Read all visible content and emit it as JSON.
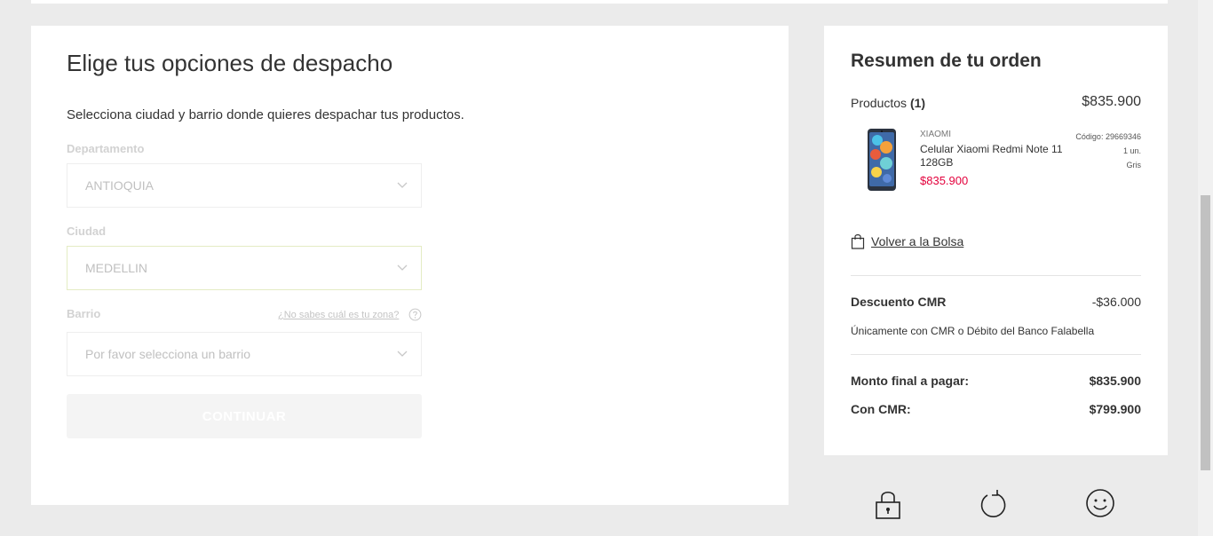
{
  "shipping": {
    "title": "Elige tus opciones de despacho",
    "subtitle": "Selecciona ciudad y barrio donde quieres despachar tus productos.",
    "department": {
      "label": "Departamento",
      "value": "ANTIOQUIA"
    },
    "city": {
      "label": "Ciudad",
      "value": "MEDELLIN"
    },
    "neighborhood": {
      "label": "Barrio",
      "help_link": "¿No sabes cuál es tu zona?",
      "placeholder": "Por favor selecciona un barrio"
    },
    "continue_label": "CONTINUAR"
  },
  "summary": {
    "title": "Resumen de tu orden",
    "products_label": "Productos",
    "products_count": "(1)",
    "products_total": "$835.900",
    "item": {
      "brand": "XIAOMI",
      "name": "Celular Xiaomi Redmi Note 11 128GB",
      "price": "$835.900",
      "code": "Código: 29669346",
      "quantity": "1 un.",
      "color": "Gris"
    },
    "back_link": "Volver a la Bolsa",
    "discount_label": "Descuento CMR",
    "discount_value": "-$36.000",
    "discount_note": "Únicamente con CMR o Débito del Banco Falabella",
    "final_label": "Monto final a pagar:",
    "final_value": "$835.900",
    "cmr_label": "Con CMR:",
    "cmr_value": "$799.900"
  },
  "icons": {
    "lock": "lock-icon",
    "return": "return-icon",
    "smile": "smile-icon"
  },
  "colors": {
    "price_red": "#e3003c",
    "active_border": "#e4ecc4"
  }
}
